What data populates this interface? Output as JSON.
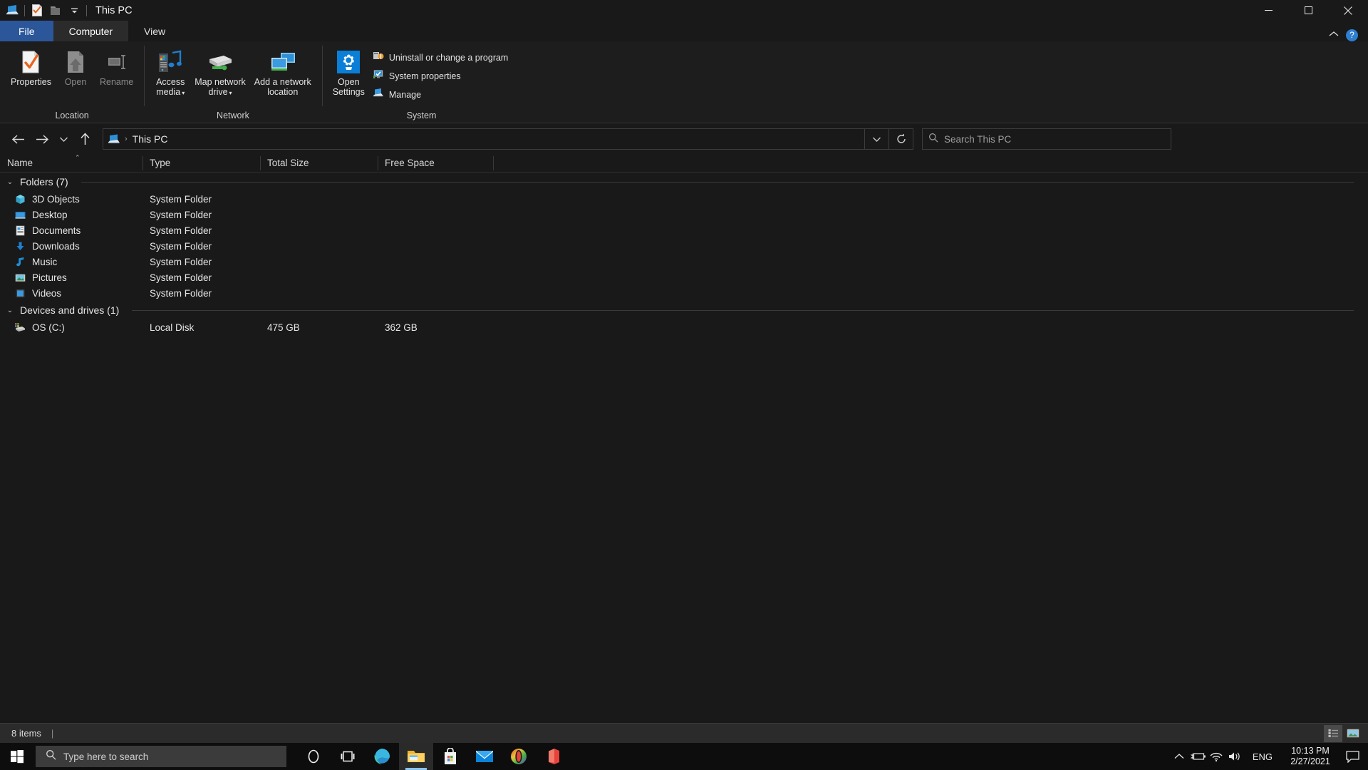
{
  "window": {
    "title": "This PC",
    "qat": [
      {
        "name": "this-pc-icon",
        "label": "This PC"
      },
      {
        "name": "properties-quick-icon",
        "label": "Properties"
      },
      {
        "name": "new-folder-quick-icon",
        "label": "New folder"
      },
      {
        "name": "customize-quick-access-toolbar-icon",
        "label": "Customize Quick Access Toolbar"
      }
    ],
    "controls": {
      "minimize": "—",
      "maximize": "☐",
      "close": "✕"
    }
  },
  "ribbon": {
    "tabs": [
      {
        "label": "File",
        "id": "file",
        "active": false
      },
      {
        "label": "Computer",
        "id": "computer",
        "active": true
      },
      {
        "label": "View",
        "id": "view",
        "active": false
      }
    ],
    "collapse_label": "⌃",
    "help_label": "?",
    "groups": [
      {
        "label": "Location",
        "buttons": [
          {
            "label": "Properties",
            "icon": "properties-icon",
            "enabled": true
          },
          {
            "label": "Open",
            "icon": "open-icon",
            "enabled": false
          },
          {
            "label": "Rename",
            "icon": "rename-icon",
            "enabled": false
          }
        ]
      },
      {
        "label": "Network",
        "buttons": [
          {
            "label": "Access\nmedia",
            "icon": "access-media-icon",
            "dropdown": true,
            "enabled": true
          },
          {
            "label": "Map network\ndrive",
            "icon": "map-network-drive-icon",
            "dropdown": true,
            "enabled": true
          },
          {
            "label": "Add a network\nlocation",
            "icon": "add-network-location-icon",
            "dropdown": false,
            "enabled": true
          }
        ]
      },
      {
        "label": "System",
        "buttons": [
          {
            "label": "Open\nSettings",
            "icon": "open-settings-icon",
            "dropdown": false,
            "enabled": true
          }
        ],
        "small_buttons": [
          {
            "label": "Uninstall or change a program",
            "icon": "uninstall-program-icon"
          },
          {
            "label": "System properties",
            "icon": "system-properties-icon"
          },
          {
            "label": "Manage",
            "icon": "manage-icon"
          }
        ]
      }
    ]
  },
  "nav": {
    "back": "←",
    "forward": "→",
    "recent": "⌄",
    "up": "↑",
    "breadcrumb": [
      "This PC"
    ],
    "breadcrumb_separator": "›",
    "address_dropdown": "⌄",
    "refresh": "↻"
  },
  "search": {
    "placeholder": "Search This PC",
    "icon": "search-icon"
  },
  "columns": [
    {
      "label": "Name",
      "sorted": "asc",
      "sort_glyph": "⌃"
    },
    {
      "label": "Type",
      "sorted": ""
    },
    {
      "label": "Total Size",
      "sorted": ""
    },
    {
      "label": "Free Space",
      "sorted": ""
    }
  ],
  "groups": [
    {
      "title": "Folders (7)",
      "chevron": "⌄",
      "rows": [
        {
          "name": "3D Objects",
          "type": "System Folder",
          "size": "",
          "free": "",
          "icon": "3d-objects-icon"
        },
        {
          "name": "Desktop",
          "type": "System Folder",
          "size": "",
          "free": "",
          "icon": "desktop-icon"
        },
        {
          "name": "Documents",
          "type": "System Folder",
          "size": "",
          "free": "",
          "icon": "documents-icon"
        },
        {
          "name": "Downloads",
          "type": "System Folder",
          "size": "",
          "free": "",
          "icon": "downloads-icon"
        },
        {
          "name": "Music",
          "type": "System Folder",
          "size": "",
          "free": "",
          "icon": "music-icon"
        },
        {
          "name": "Pictures",
          "type": "System Folder",
          "size": "",
          "free": "",
          "icon": "pictures-icon"
        },
        {
          "name": "Videos",
          "type": "System Folder",
          "size": "",
          "free": "",
          "icon": "videos-icon"
        }
      ]
    },
    {
      "title": "Devices and drives (1)",
      "chevron": "⌄",
      "rows": [
        {
          "name": "OS (C:)",
          "type": "Local Disk",
          "size": "475 GB",
          "free": "362 GB",
          "icon": "local-disk-icon"
        }
      ]
    }
  ],
  "status": {
    "item_count": "8 items",
    "separator": "|",
    "views": [
      {
        "name": "details-view-button",
        "selected": true
      },
      {
        "name": "large-icons-view-button",
        "selected": false
      }
    ]
  },
  "taskbar": {
    "start_label": "Start",
    "search_placeholder": "Type here to search",
    "search_icon": "search-icon",
    "icons": [
      {
        "name": "cortana-icon",
        "active": false
      },
      {
        "name": "task-view-icon",
        "active": false
      },
      {
        "name": "microsoft-edge-icon",
        "active": false
      },
      {
        "name": "file-explorer-icon",
        "active": true
      },
      {
        "name": "microsoft-store-icon",
        "active": false
      },
      {
        "name": "mail-icon",
        "active": false
      },
      {
        "name": "opera-icon",
        "active": false
      },
      {
        "name": "office-icon",
        "active": false
      }
    ],
    "tray": {
      "show_hidden": "⌃",
      "battery_icon": "battery-charging-icon",
      "network_icon": "wifi-icon",
      "volume_icon": "speaker-icon",
      "language": "ENG",
      "time": "10:13 PM",
      "date": "2/27/2021",
      "action_center_icon": "action-center-icon"
    }
  },
  "colors": {
    "background": "#191919",
    "ribbon": "#1d1d1d",
    "file_tab": "#2b579a",
    "accent_blue": "#0a84d8",
    "status_bar": "#2b2b2b",
    "taskbar": "#0d0d0d",
    "text": "#e8e8e8"
  }
}
